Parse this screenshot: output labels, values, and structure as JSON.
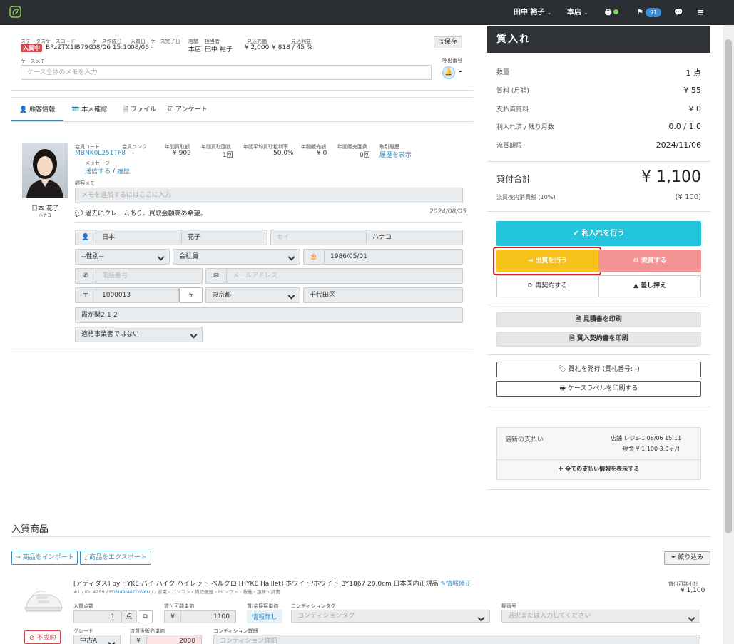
{
  "topbar": {
    "user": "田中 裕子",
    "store": "本店",
    "notification_count": "91"
  },
  "case": {
    "status_label": "ステータス",
    "status_value": "入質中",
    "code_label": "ケースコード",
    "code_value": "BPzZTX1IB79G",
    "created_label": "ケース作成日",
    "created_value": "08/06 15:10",
    "pawn_date_label": "入質日",
    "pawn_date_value": "08/06",
    "end_label": "ケース完了日",
    "end_value": "-",
    "store_label": "店舗",
    "store_value": "本店",
    "staff_label": "担当者",
    "staff_value": "田中 裕子",
    "est_sales_label": "見込売価",
    "est_sales_value": "¥ 2,000",
    "est_profit_label": "見込利益",
    "est_profit_value": "¥ 818 / 45 %",
    "save_label": "保存",
    "memo_label": "ケースメモ",
    "memo_placeholder": "ケース全体のメモを入力",
    "call_label": "呼出番号",
    "call_value": "–"
  },
  "tabs": [
    "顧客情報",
    "本人確認",
    "ファイル",
    "アンケート"
  ],
  "customer": {
    "member_code_label": "会員コード",
    "member_code": "MBNK0L251TP8",
    "rank_label": "会員ランク",
    "rank": "-",
    "annual_buy_label": "年間買取額",
    "annual_buy": "¥ 909",
    "annual_buy_count_label": "年間買取回数",
    "annual_buy_count": "1回",
    "avg_margin_label": "年間平均買取粗利率",
    "avg_margin": "50.0%",
    "annual_sales_label": "年間販売額",
    "annual_sales": "¥ 0",
    "annual_sales_count_label": "年間販売回数",
    "annual_sales_count": "0回",
    "history_label": "取引履歴",
    "history_link": "履歴を表示",
    "message_label": "メッセージ",
    "message_send": "送信する",
    "message_sep": "/",
    "message_history": "履歴",
    "name": "日本 花子",
    "kana": "ハナコ",
    "memo_label": "顧客メモ",
    "memo_placeholder": "メモを追加するにはここに入力",
    "note": "過去にクレームあり。買取金額高め希望。",
    "note_date": "2024/08/05",
    "last_name": "日本",
    "first_name": "花子",
    "last_kana_placeholder": "セイ",
    "first_kana": "ハナコ",
    "gender": "--性別--",
    "occupation": "会社員",
    "birthday": "1986/05/01",
    "phone_placeholder": "電話番号",
    "email_placeholder": "メールアドレス",
    "postal": "1000013",
    "prefecture": "東京都",
    "city": "千代田区",
    "address": "霞が関2-1-2",
    "invoice": "適格事業者ではない"
  },
  "panel": {
    "title": "質入れ",
    "rows": [
      {
        "label": "数量",
        "value": "1 点"
      },
      {
        "label": "質料 (月額)",
        "value": "¥ 55"
      },
      {
        "label": "支払済質料",
        "value": "¥ 0"
      },
      {
        "label": "利入れ済 / 残り月数",
        "value": "0.0 / 1.0"
      },
      {
        "label": "流質期限",
        "value": "2024/11/06"
      }
    ],
    "loan_total_label": "貸付合計",
    "loan_total": "¥ 1,100",
    "tax_label": "流質後内消費税 (10%)",
    "tax_value": "(¥ 100)",
    "btn_interest": "利入れを行う",
    "btn_redeem": "出質を行う",
    "btn_forfeit": "流質する",
    "btn_recontract": "再契約する",
    "btn_seize": "差し押え",
    "btn_print_estimate": "見積書を印刷",
    "btn_print_contract": "質入契約書を印刷",
    "btn_ticket": "質札を発行 (質札番号: -)",
    "btn_label": "ケースラベルを印刷する",
    "latest_payment_label": "最新の支払い",
    "pay_store": "店舗",
    "pay_register": "レジB-1",
    "pay_time": "08/06 15:11",
    "pay_method": "現金",
    "pay_amount": "¥ 1,100",
    "pay_months": "3.0ヶ月",
    "show_all": "全ての支払い情報を表示する"
  },
  "products": {
    "section_title": "入質商品",
    "import_btn": "商品をインポート",
    "export_btn": "商品をエクスポート",
    "filter_btn": "絞り込み",
    "item_title": "[アディダス] by HYKE バイ ハイク ハイレット ベルクロ [HYKE Haillet] ホワイト/ホワイト BY1867 28.0cm 日本国内正規品",
    "edit_link": "情報修正",
    "item_meta_id": "#1 / ID: 4259 / ",
    "item_meta_code": "PDM49M4ZOWAU",
    "item_meta_path": " /  / 家電 › パソコン・周辺機器 › PCソフト › 教養・趣味 › 辞書",
    "subtotal_label": "貸付可能小計",
    "subtotal": "¥ 1,100",
    "qty_label": "入質点数",
    "qty": "1",
    "qty_unit": "点",
    "unit_price_label": "貸付可能単価",
    "unit_price": "1100",
    "currency": "¥",
    "buy_price_label": "買/余接接単価",
    "buy_price_value": "情報無し",
    "cond_tag_label": "コンディションタグ",
    "cond_tag_placeholder": "コンディションタグ",
    "shelf_label": "棚番号",
    "shelf_placeholder": "選択または入力してください",
    "status_badge": "不成約",
    "grade_label": "グレード",
    "grade": "中古A",
    "after_price_label": "流質後販売単価",
    "after_price": "2000",
    "cond_detail_label": "コンディション詳細",
    "cond_detail_placeholder": "コンディション詳細"
  }
}
